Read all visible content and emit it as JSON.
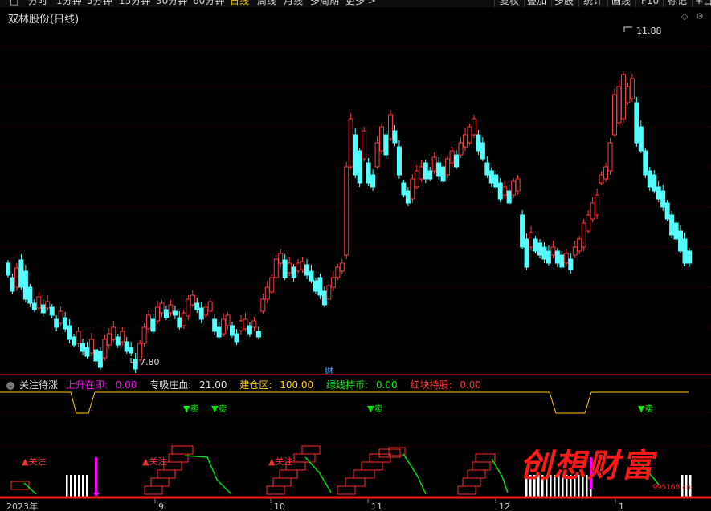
{
  "toolbar": {
    "items": [
      "分时",
      "1分钟",
      "5分钟",
      "15分钟",
      "30分钟",
      "60分钟",
      "日线",
      "周线",
      "月线",
      "多周期",
      "更多 >"
    ],
    "active": "日线",
    "right_items": [
      "复权",
      "叠加",
      "多股",
      "统计",
      "画线",
      "F10",
      "标记",
      "+自"
    ]
  },
  "chart": {
    "title": "双林股份(日线)",
    "high_label": "11.88",
    "low_label": "7.80",
    "cai_label": "财",
    "up_color": "#ff3b3b",
    "down_color": "#54ffff"
  },
  "indicator": {
    "name": "关注待涨",
    "fields": [
      {
        "label": "上升在即:",
        "value": "0.00",
        "color": "#ff00ff"
      },
      {
        "label": "专吸庄血:",
        "value": "21.00",
        "color": "#e0e0e0"
      },
      {
        "label": "建仓区:",
        "value": "100.00",
        "color": "#ffcc00"
      },
      {
        "label": "绿线持币:",
        "value": "0.00",
        "color": "#00ee00"
      },
      {
        "label": "红块持股:",
        "value": "0.00",
        "color": "#ff3333"
      }
    ],
    "sell_label": "▼卖",
    "focus_label": "▲关注"
  },
  "axis": {
    "labels": [
      "2023年",
      "9",
      "10",
      "11",
      "12",
      "1"
    ]
  },
  "watermark": {
    "text": "创想财富",
    "url": "995168.cn"
  }
}
